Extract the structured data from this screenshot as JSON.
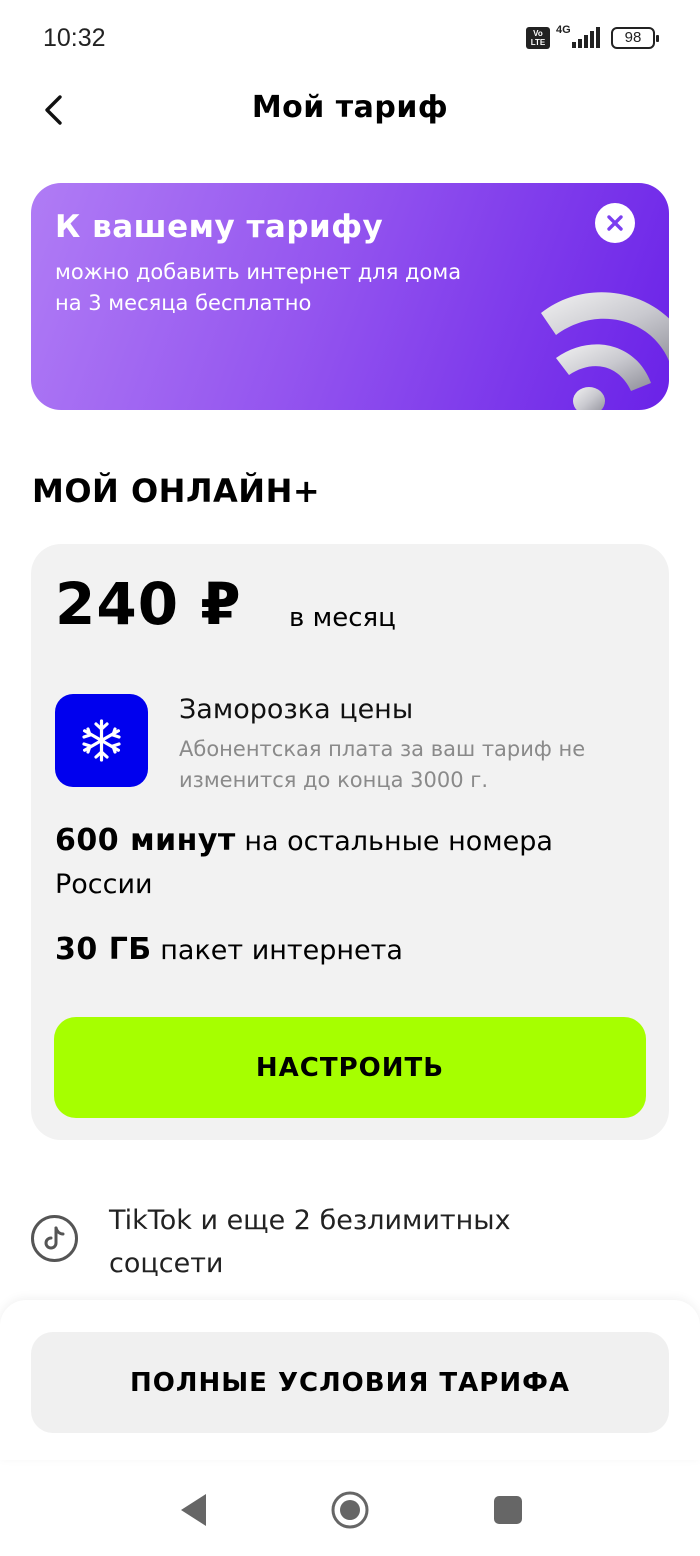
{
  "status_bar": {
    "time": "10:32",
    "volte": "Vo LTE",
    "network": "4G",
    "battery": "98",
    "icons": [
      "volte-icon",
      "signal-icon",
      "battery-icon"
    ]
  },
  "header": {
    "title": "Мой тариф",
    "back_icon": "chevron-left-icon"
  },
  "banner": {
    "title": "К вашему тарифу",
    "text": "можно добавить интернет для дома на 3 месяца бесплатно",
    "close_icon": "close-icon",
    "art_icon": "wifi-icon",
    "gradient": [
      "#b07cf5",
      "#6a22e8"
    ]
  },
  "tariff": {
    "name": "МОЙ ОНЛАЙН+",
    "price": "240 ₽",
    "period": "в месяц",
    "freeze": {
      "icon": "snowflake-icon",
      "title": "Заморозка цены",
      "description": "Абонентская плата за ваш тариф не изменится до конца 3000 г."
    },
    "features": [
      {
        "value": "600 минут",
        "text": "на остальные номера России"
      },
      {
        "value": "30 ГБ",
        "text": "пакет интернета"
      }
    ],
    "configure_label": "НАСТРОИТЬ",
    "accent_color": "#a6ff00"
  },
  "social": {
    "icon": "tiktok-icon",
    "text": "TikTok и еще 2 безлимитных соцсети"
  },
  "footer": {
    "full_terms_label": "ПОЛНЫЕ УСЛОВИЯ ТАРИФА"
  },
  "nav_bar": {
    "icons": [
      "nav-back-icon",
      "nav-home-icon",
      "nav-recents-icon"
    ]
  }
}
